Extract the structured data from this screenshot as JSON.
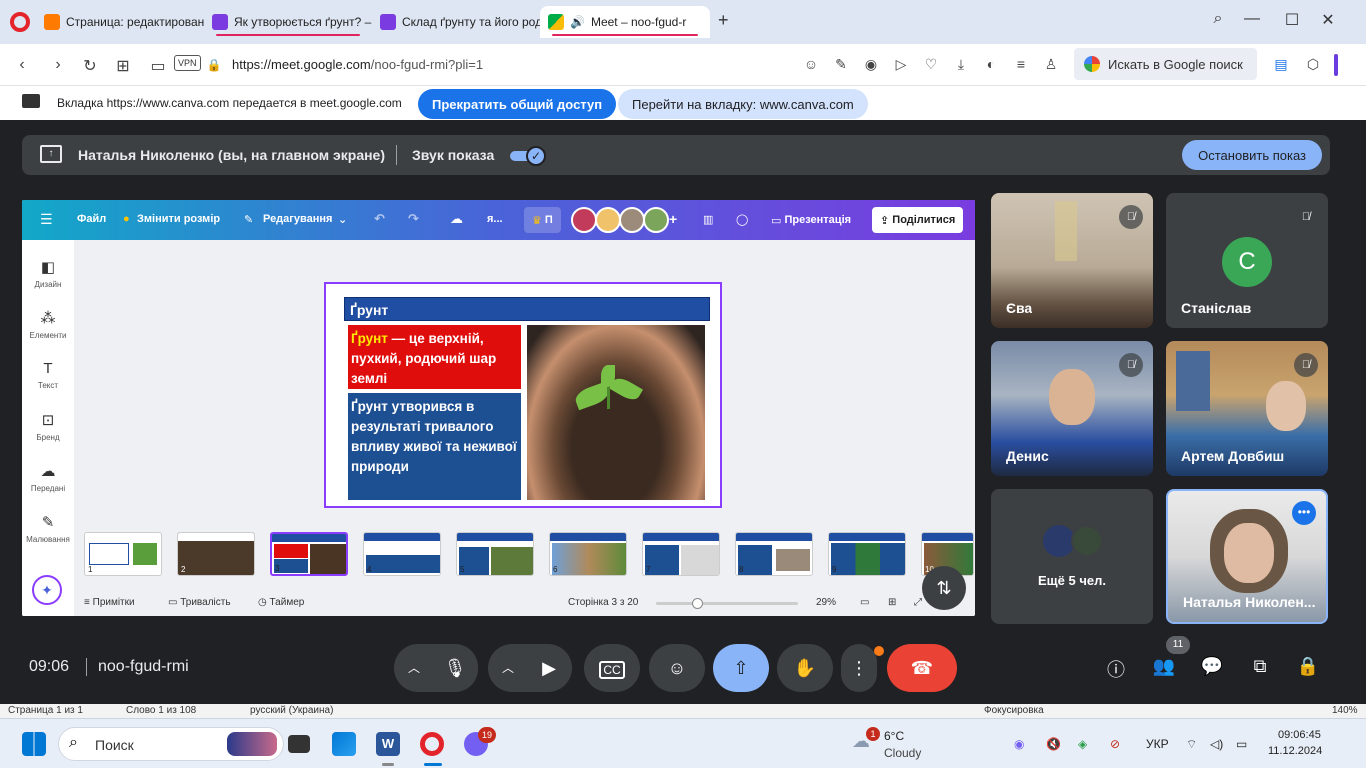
{
  "browser": {
    "tabs": [
      {
        "title": "Страница: редактирован",
        "active": false
      },
      {
        "title": "Як утворюється ґрунт? –",
        "active": false
      },
      {
        "title": "Склад ґрунту та його род",
        "active": false
      },
      {
        "title": "Meet – noo-fgud-r",
        "active": true
      }
    ],
    "new_tab": "+",
    "url_host": "https://meet.google.com",
    "url_path": "/noo-fgud-rmi?pli=1",
    "vpn": "VPN",
    "search_label": "Искать в Google поиск"
  },
  "sharing_notice": {
    "text": "Вкладка https://www.canva.com передается в meet.google.com",
    "stop_label": "Прекратить общий доступ",
    "goto_label": "Перейти на вкладку: www.canva.com"
  },
  "presenter_bar": {
    "presenter": "Наталья Николенко (вы, на главном экране)",
    "sound_label": "Звук показа",
    "stop_label": "Остановить показ"
  },
  "canva": {
    "menu": {
      "file": "Файл",
      "resize": "Змінити розмір",
      "edit": "Редагування",
      "overflow": "я...",
      "present": "Презентація",
      "share": "Поділитися"
    },
    "sidebar": [
      {
        "label": "Дизайн",
        "icon": "design-icon"
      },
      {
        "label": "Елементи",
        "icon": "elements-icon"
      },
      {
        "label": "Текст",
        "icon": "text-icon"
      },
      {
        "label": "Бренд",
        "icon": "brand-icon"
      },
      {
        "label": "Передані",
        "icon": "uploads-icon"
      },
      {
        "label": "Малювання",
        "icon": "draw-icon"
      }
    ],
    "slide": {
      "title": "Ґрунт",
      "definition_highlight": "Ґрунт",
      "definition_rest": " — це верхній, пухкий, родючий шар землі",
      "formation": "Ґрунт утворився в результаті тривалого впливу живої та неживої природи"
    },
    "thumbnails": [
      "1",
      "2",
      "3",
      "4",
      "5",
      "6",
      "7",
      "8",
      "9",
      "10"
    ],
    "selected_thumbnail": 3,
    "bottom": {
      "notes": "Примітки",
      "duration": "Тривалість",
      "timer": "Таймер",
      "page": "Сторінка 3 з 20",
      "zoom": "29%"
    }
  },
  "participants": [
    {
      "name": "Єва",
      "muted": true
    },
    {
      "name": "Станіслав",
      "muted": true,
      "initial": "C"
    },
    {
      "name": "Денис",
      "muted": true
    },
    {
      "name": "Артем Довбиш",
      "muted": true
    },
    {
      "name": "Ещё 5 чел."
    },
    {
      "name": "Наталья Николен..."
    }
  ],
  "meeting": {
    "time": "09:06",
    "code": "noo-fgud-rmi",
    "people_count": "11"
  },
  "status_strip": {
    "left1": "Страница 1 из 1",
    "left2": "Слово 1 из 108",
    "lang": "русский (Украина)",
    "focus": "Фокусировка",
    "zoom": "140%"
  },
  "taskbar": {
    "search": "Поиск",
    "weather_temp": "6°C",
    "weather_desc": "Cloudy",
    "weather_badge": "1",
    "viber_badge": "19",
    "lang": "УКР",
    "time": "09:06:45",
    "date": "11.12.2024"
  },
  "colors": {
    "meet_bg": "#202124",
    "accent_blue": "#8ab4f8",
    "end_call": "#ea4335",
    "canva_purple": "#8b3dff",
    "share_pill": "#1a73e8"
  }
}
